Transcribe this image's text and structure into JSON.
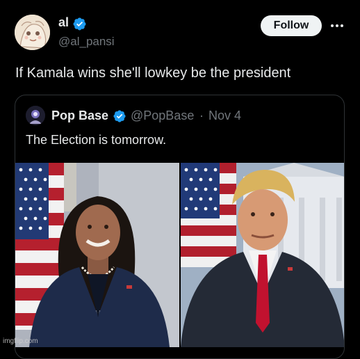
{
  "post": {
    "author_name": "al",
    "author_handle": "@al_pansi",
    "follow_label": "Follow",
    "text": "If Kamala wins she'll lowkey be the president"
  },
  "quote": {
    "author_name": "Pop Base",
    "author_handle": "@PopBase",
    "separator": "·",
    "date": "Nov 4",
    "text": "The Election is tomorrow."
  },
  "images": [
    {
      "subject": "woman-portrait-with-flag"
    },
    {
      "subject": "man-portrait-with-flag-white-house"
    }
  ],
  "watermark": "imgflip.com",
  "icons": {
    "verified": "verified-badge-icon",
    "more": "more-options-icon"
  },
  "colors": {
    "background": "#000000",
    "text_primary": "#e7e9ea",
    "text_secondary": "#71767b",
    "verified_blue": "#1d9bf0",
    "follow_bg": "#eff3f4",
    "border": "#2f3336"
  }
}
